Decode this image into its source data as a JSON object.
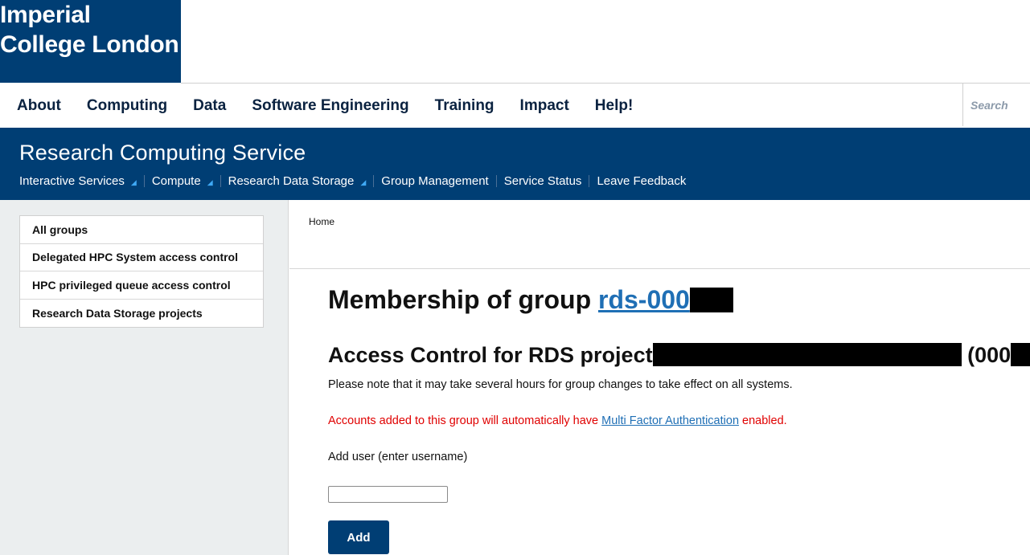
{
  "brand": {
    "line1": "Imperial",
    "line2": "College London"
  },
  "main_nav": {
    "items": [
      "About",
      "Computing",
      "Data",
      "Software Engineering",
      "Training",
      "Impact",
      "Help!"
    ],
    "search_placeholder": "Search"
  },
  "service": {
    "title": "Research Computing Service",
    "subnav": [
      {
        "label": "Interactive Services",
        "has_dropdown": true
      },
      {
        "label": "Compute",
        "has_dropdown": true
      },
      {
        "label": "Research Data Storage",
        "has_dropdown": true
      },
      {
        "label": "Group Management",
        "has_dropdown": false
      },
      {
        "label": "Service Status",
        "has_dropdown": false
      },
      {
        "label": "Leave Feedback",
        "has_dropdown": false
      }
    ]
  },
  "sidebar": {
    "items": [
      "All groups",
      "Delegated HPC System access control",
      "HPC privileged queue access control",
      "Research Data Storage projects"
    ]
  },
  "breadcrumb": {
    "home": "Home"
  },
  "content": {
    "heading_prefix": "Membership of group ",
    "group_link": "rds-000",
    "subheading_prefix": "Access Control for RDS project",
    "subheading_suffix_open": " (000",
    "subheading_suffix_close": ")",
    "note": "Please note that it may take several hours for group changes to take effect on all systems.",
    "warning_before": "Accounts added to this group will automatically have ",
    "warning_link": "Multi Factor Authentication",
    "warning_after": " enabled.",
    "add_label": "Add user (enter username)",
    "input_value": "",
    "add_button": "Add"
  },
  "colors": {
    "brand_blue": "#003e74",
    "link_blue": "#1f6fb5",
    "warning_red": "#e00000",
    "sidebar_bg": "#ebeeef"
  }
}
